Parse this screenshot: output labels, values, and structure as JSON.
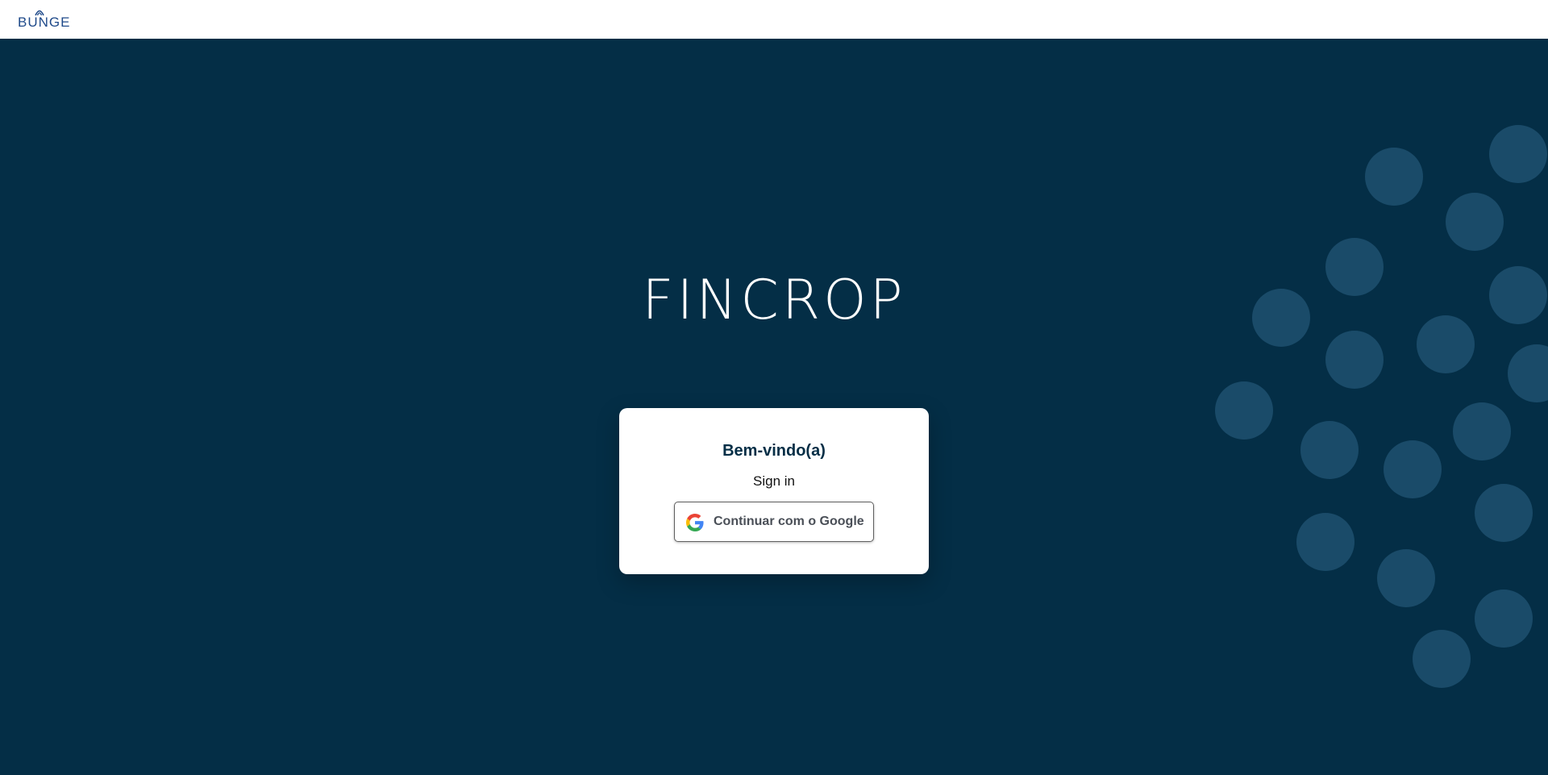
{
  "header": {
    "brand_name": "BUNGE"
  },
  "main": {
    "app_title": "FINCROP",
    "login_card": {
      "heading": "Bem-vindo(a)",
      "subheading": "Sign in",
      "google_button_label": "Continuar com o Google"
    }
  },
  "colors": {
    "background": "#042e46",
    "dot": "#1a4b69",
    "brand": "#1f4a8a",
    "card": "#ffffff"
  },
  "icons": {
    "brand": "bunge-logo-icon",
    "google": "google-icon"
  }
}
